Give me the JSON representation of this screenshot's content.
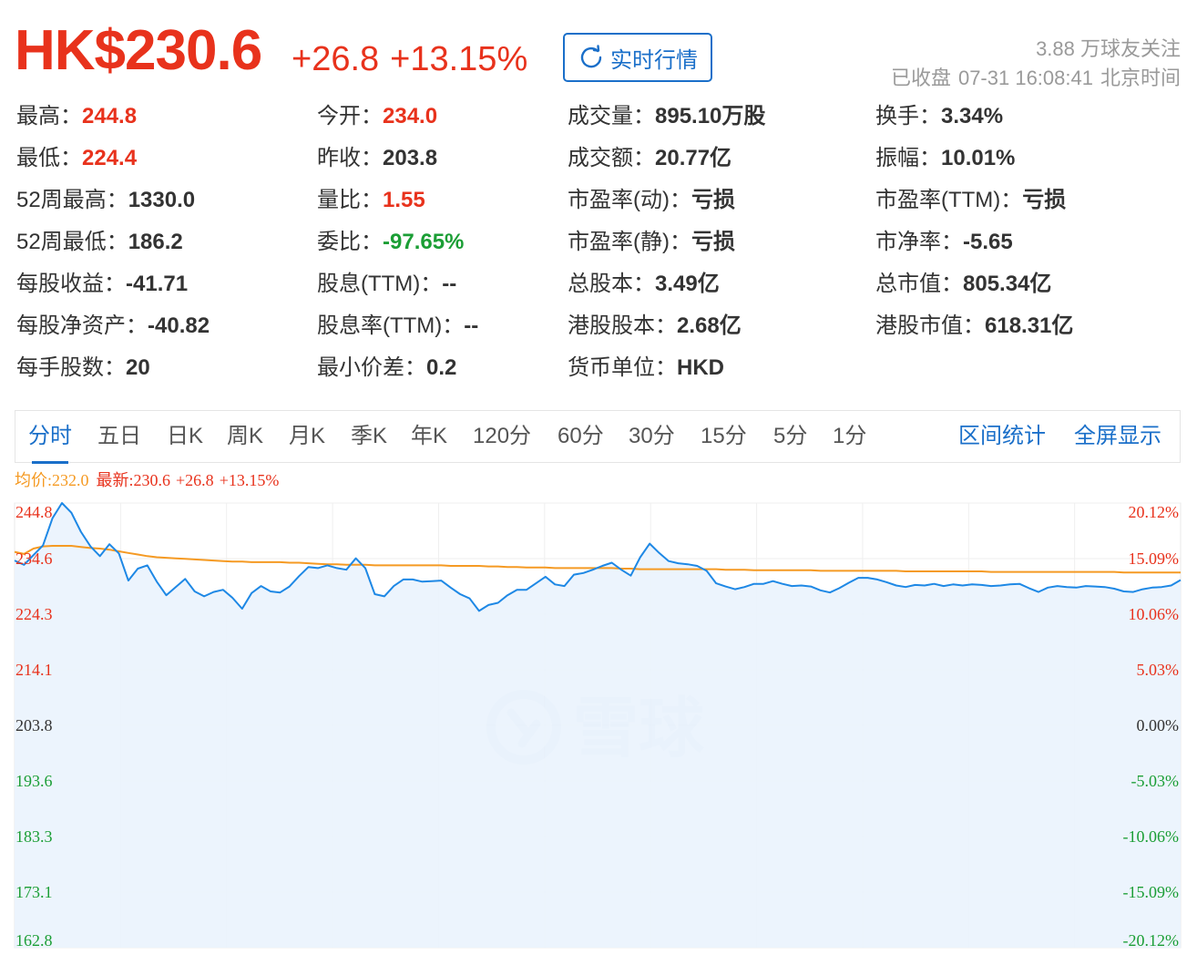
{
  "header": {
    "price": "HK$230.6",
    "change": "+26.8",
    "change_pct": "+13.15%",
    "realtime_button": "实时行情",
    "followers": "3.88 万球友关注",
    "status": "已收盘",
    "datetime": "07-31 16:08:41",
    "timezone": "北京时间"
  },
  "quote": {
    "c1": [
      {
        "label": "最高：",
        "value": "244.8",
        "color": "red"
      },
      {
        "label": "最低：",
        "value": "224.4",
        "color": "red"
      },
      {
        "label": "52周最高：",
        "value": "1330.0"
      },
      {
        "label": "52周最低：",
        "value": "186.2"
      },
      {
        "label": "每股收益：",
        "value": "-41.71"
      },
      {
        "label": "每股净资产：",
        "value": "-40.82"
      },
      {
        "label": "每手股数：",
        "value": "20"
      }
    ],
    "c2": [
      {
        "label": "今开：",
        "value": "234.0",
        "color": "red"
      },
      {
        "label": "昨收：",
        "value": "203.8"
      },
      {
        "label": "量比：",
        "value": "1.55",
        "color": "red"
      },
      {
        "label": "委比：",
        "value": "-97.65%",
        "color": "green"
      },
      {
        "label": "股息(TTM)：",
        "value": "--"
      },
      {
        "label": "股息率(TTM)：",
        "value": "--"
      },
      {
        "label": "最小价差：",
        "value": "0.2"
      }
    ],
    "c3": [
      {
        "label": "成交量：",
        "value": "895.10万股"
      },
      {
        "label": "成交额：",
        "value": "20.77亿"
      },
      {
        "label": "市盈率(动)：",
        "value": "亏损"
      },
      {
        "label": "市盈率(静)：",
        "value": "亏损"
      },
      {
        "label": "总股本：",
        "value": "3.49亿"
      },
      {
        "label": "港股股本：",
        "value": "2.68亿"
      },
      {
        "label": "货币单位：",
        "value": "HKD"
      }
    ],
    "c4": [
      {
        "label": "换手：",
        "value": "3.34%"
      },
      {
        "label": "振幅：",
        "value": "10.01%"
      },
      {
        "label": "市盈率(TTM)：",
        "value": "亏损"
      },
      {
        "label": "市净率：",
        "value": "-5.65"
      },
      {
        "label": "总市值：",
        "value": "805.34亿"
      },
      {
        "label": "港股市值：",
        "value": "618.31亿"
      }
    ]
  },
  "tabs": {
    "items": [
      "分时",
      "五日",
      "日K",
      "周K",
      "月K",
      "季K",
      "年K",
      "120分",
      "60分",
      "30分",
      "15分",
      "5分",
      "1分"
    ],
    "active": "分时",
    "range_stats": "区间统计",
    "fullscreen": "全屏显示"
  },
  "legend": {
    "avg": "均价:232.0",
    "latest_label": "最新:230.6",
    "latest_change": "+26.8",
    "latest_pct": "+13.15%"
  },
  "watermark": "雪球",
  "colors": {
    "up": "#e8321c",
    "down": "#1b9e35",
    "accent": "#1a6fc9",
    "price_line": "#1e88e5",
    "avg_line": "#f59a23",
    "neutral": "#333333"
  },
  "chart_data": {
    "type": "line",
    "prev_close": 203.8,
    "ylim": [
      162.8,
      244.8
    ],
    "y_ticks": [
      "244.8",
      "234.6",
      "224.3",
      "214.1",
      "203.8",
      "193.6",
      "183.3",
      "173.1",
      "162.8"
    ],
    "y_ticks_pct": [
      "20.12%",
      "15.09%",
      "10.06%",
      "5.03%",
      "0.00%",
      "-5.03%",
      "-10.06%",
      "-15.09%",
      "-20.12%"
    ],
    "series": [
      {
        "values": [
          234.2,
          233.4,
          235.2,
          237.0,
          242.0,
          244.8,
          243.0,
          239.5,
          236.8,
          235.0,
          237.2,
          235.5,
          230.5,
          232.7,
          233.3,
          230.3,
          227.8,
          229.3,
          230.8,
          228.5,
          227.6,
          228.4,
          228.8,
          227.3,
          225.3,
          228.2,
          229.5,
          228.5,
          228.3,
          229.4,
          231.3,
          233.0,
          232.8,
          233.3,
          232.8,
          232.5,
          234.6,
          232.8,
          228.0,
          227.6,
          229.5,
          230.7,
          230.7,
          230.3,
          230.4,
          230.5,
          229.2,
          228.0,
          227.2,
          224.9,
          226.0,
          226.4,
          227.8,
          228.8,
          228.8,
          230.0,
          231.2,
          229.8,
          229.5,
          231.6,
          231.9,
          232.5,
          233.2,
          233.8,
          232.5,
          231.4,
          234.8,
          237.3,
          235.6,
          234.1,
          233.7,
          233.5,
          233.2,
          232.3,
          230.0,
          229.4,
          228.9,
          229.3,
          229.9,
          229.9,
          230.4,
          229.9,
          229.5,
          229.6,
          229.4,
          228.7,
          228.3,
          229.1,
          230.1,
          231.0,
          231.0,
          230.7,
          230.2,
          229.6,
          229.3,
          229.7,
          229.6,
          229.9,
          229.5,
          229.8,
          229.6,
          229.8,
          229.7,
          229.5,
          229.6,
          229.8,
          229.9,
          229.1,
          228.4,
          229.2,
          229.5,
          229.3,
          229.2,
          229.5,
          229.4,
          229.3,
          229.0,
          228.5,
          228.4,
          228.9,
          229.2,
          229.3,
          229.6,
          230.6
        ]
      },
      {
        "name": "均价",
        "values": [
          235.8,
          235.4,
          236.4,
          236.8,
          236.9,
          236.9,
          236.9,
          236.7,
          236.5,
          236.4,
          236.2,
          235.9,
          235.6,
          235.3,
          235.0,
          234.8,
          234.7,
          234.6,
          234.5,
          234.4,
          234.3,
          234.2,
          234.1,
          234.0,
          234.0,
          233.9,
          233.9,
          233.9,
          233.9,
          233.8,
          233.8,
          233.7,
          233.6,
          233.5,
          233.5,
          233.4,
          233.4,
          233.4,
          233.3,
          233.3,
          233.3,
          233.3,
          233.3,
          233.3,
          233.3,
          233.3,
          233.2,
          233.2,
          233.2,
          233.2,
          233.1,
          233.1,
          233.0,
          233.0,
          232.9,
          232.9,
          232.9,
          232.8,
          232.8,
          232.8,
          232.8,
          232.8,
          232.8,
          232.8,
          232.7,
          232.7,
          232.6,
          232.6,
          232.6,
          232.6,
          232.6,
          232.6,
          232.6,
          232.6,
          232.6,
          232.5,
          232.5,
          232.5,
          232.4,
          232.4,
          232.4,
          232.4,
          232.4,
          232.4,
          232.4,
          232.3,
          232.3,
          232.3,
          232.3,
          232.3,
          232.3,
          232.3,
          232.3,
          232.3,
          232.2,
          232.2,
          232.2,
          232.2,
          232.2,
          232.2,
          232.2,
          232.2,
          232.2,
          232.1,
          232.1,
          232.1,
          232.1,
          232.1,
          232.1,
          232.1,
          232.1,
          232.1,
          232.1,
          232.1,
          232.1,
          232.1,
          232.1,
          232.0,
          232.0,
          232.0,
          232.0,
          232.0,
          232.0,
          232.0
        ]
      }
    ]
  }
}
